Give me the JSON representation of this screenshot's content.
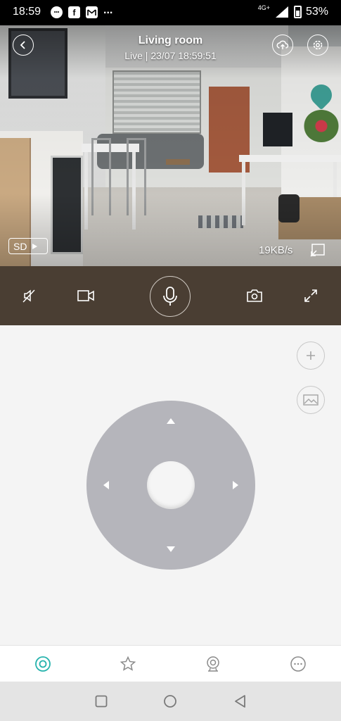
{
  "status_bar": {
    "time": "18:59",
    "notification_icons": [
      "chat-bubble-icon",
      "facebook-icon",
      "gmail-icon"
    ],
    "more": "...",
    "network": "4G+",
    "battery": "53%"
  },
  "camera": {
    "title": "Living room",
    "subtitle": "Live | 23/07 18:59:51",
    "quality": "SD",
    "data_rate": "19KB/s"
  },
  "controls": [
    "mute-icon",
    "record-video-icon",
    "microphone-icon",
    "screenshot-camera-icon",
    "fullscreen-icon"
  ],
  "side_buttons": [
    "zoom-in-plus-icon",
    "gallery-image-icon"
  ],
  "bottom_nav": [
    "live-view-icon",
    "favorites-star-icon",
    "camera-device-icon",
    "messages-icon"
  ],
  "bottom_nav_active": 0,
  "colors": {
    "accent": "#26b3ad",
    "control_bar": "#4a3e33",
    "joystick": "#b5b5bb"
  }
}
